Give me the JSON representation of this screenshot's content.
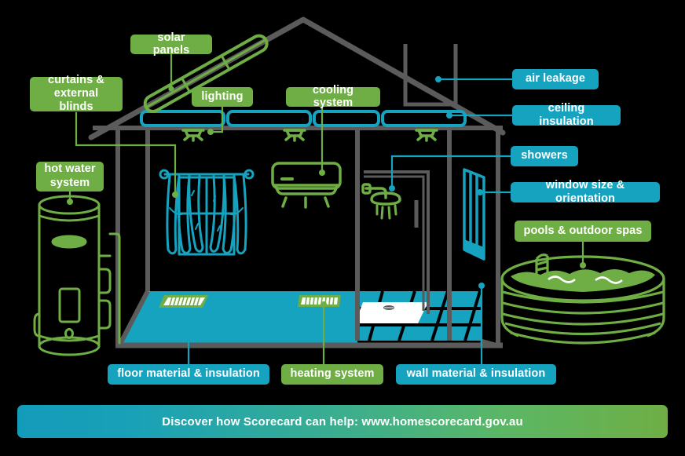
{
  "diagram": {
    "title": "Home energy features house cutaway diagram",
    "colors": {
      "green": "#6FAE44",
      "teal": "#16A3C0",
      "grey_structure": "#5B5B5B",
      "floor_teal": "#16A3C0",
      "background": "#000000",
      "white": "#FFFFFF"
    }
  },
  "labels": [
    {
      "id": "solar-panels",
      "text": "solar panels",
      "color": "green"
    },
    {
      "id": "curtains",
      "text": "curtains &\nexternal blinds",
      "color": "green"
    },
    {
      "id": "lighting",
      "text": "lighting",
      "color": "green"
    },
    {
      "id": "cooling-system",
      "text": "cooling system",
      "color": "green"
    },
    {
      "id": "hot-water-system",
      "text": "hot water\nsystem",
      "color": "green"
    },
    {
      "id": "air-leakage",
      "text": "air leakage",
      "color": "teal"
    },
    {
      "id": "ceiling-insulation",
      "text": "ceiling insulation",
      "color": "teal"
    },
    {
      "id": "showers",
      "text": "showers",
      "color": "teal"
    },
    {
      "id": "window-size",
      "text": "window size & orientation",
      "color": "teal"
    },
    {
      "id": "pools-spas",
      "text": "pools & outdoor spas",
      "color": "green"
    },
    {
      "id": "floor-material",
      "text": "floor material & insulation",
      "color": "teal"
    },
    {
      "id": "heating-system",
      "text": "heating system",
      "color": "green"
    },
    {
      "id": "wall-material",
      "text": "wall material & insulation",
      "color": "teal"
    }
  ],
  "banner": {
    "text": "Discover how Scorecard can help: www.homescorecard.gov.au",
    "gradient_from": "#139BBA",
    "gradient_to": "#6FAE44"
  },
  "icons": [
    {
      "name": "solar-panel-icon",
      "color": "green"
    },
    {
      "name": "curtains-window-icon",
      "color": "teal"
    },
    {
      "name": "downlight-icon",
      "color": "green"
    },
    {
      "name": "air-conditioner-icon",
      "color": "green"
    },
    {
      "name": "hot-water-tank-icon",
      "color": "green"
    },
    {
      "name": "chimney-icon",
      "color": "grey"
    },
    {
      "name": "insulation-batt-icon",
      "color": "teal"
    },
    {
      "name": "shower-head-icon",
      "color": "green"
    },
    {
      "name": "window-door-icon",
      "color": "teal"
    },
    {
      "name": "above-ground-pool-icon",
      "color": "green"
    },
    {
      "name": "floor-vent-icon",
      "color": "green"
    },
    {
      "name": "tiled-floor-icon",
      "color": "teal"
    }
  ]
}
